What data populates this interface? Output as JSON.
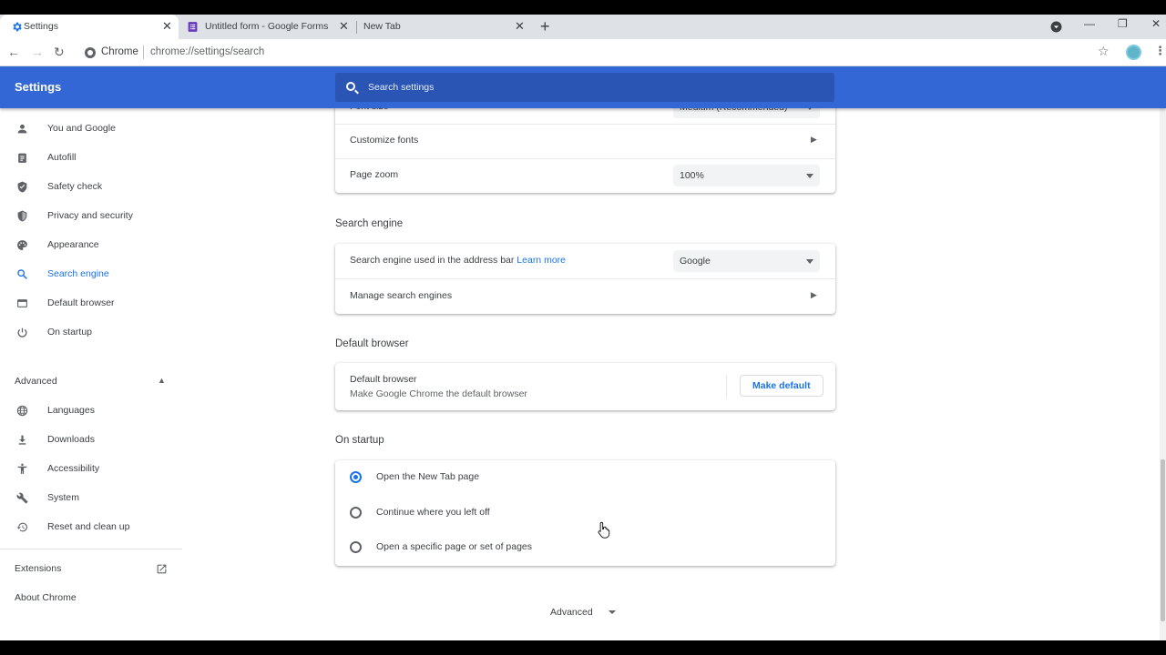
{
  "tabs": [
    {
      "title": "Settings",
      "icon": "gear-icon",
      "active": true
    },
    {
      "title": "Untitled form - Google Forms",
      "icon": "forms-icon",
      "active": false
    },
    {
      "title": "New Tab",
      "icon": "",
      "active": false
    }
  ],
  "toolbar": {
    "site_label": "Chrome",
    "url": "chrome://settings/search"
  },
  "header": {
    "title": "Settings",
    "search_placeholder": "Search settings"
  },
  "sidebar": {
    "items": [
      {
        "label": "You and Google",
        "icon": "person-icon"
      },
      {
        "label": "Autofill",
        "icon": "clipboard-icon"
      },
      {
        "label": "Safety check",
        "icon": "shield-check-icon"
      },
      {
        "label": "Privacy and security",
        "icon": "shield-icon"
      },
      {
        "label": "Appearance",
        "icon": "palette-icon"
      },
      {
        "label": "Search engine",
        "icon": "search-icon",
        "active": true
      },
      {
        "label": "Default browser",
        "icon": "browser-icon"
      },
      {
        "label": "On startup",
        "icon": "power-icon"
      }
    ],
    "advanced_label": "Advanced",
    "advanced_items": [
      {
        "label": "Languages",
        "icon": "globe-icon"
      },
      {
        "label": "Downloads",
        "icon": "download-icon"
      },
      {
        "label": "Accessibility",
        "icon": "accessibility-icon"
      },
      {
        "label": "System",
        "icon": "wrench-icon"
      },
      {
        "label": "Reset and clean up",
        "icon": "history-icon"
      }
    ],
    "extensions_label": "Extensions",
    "about_label": "About Chrome"
  },
  "appearance": {
    "font_size_label": "Font size",
    "font_size_value": "Medium (Recommended)",
    "customize_fonts_label": "Customize fonts",
    "page_zoom_label": "Page zoom",
    "page_zoom_value": "100%"
  },
  "search_engine": {
    "title": "Search engine",
    "used_label": "Search engine used in the address bar",
    "learn_more": "Learn more",
    "value": "Google",
    "manage_label": "Manage search engines"
  },
  "default_browser": {
    "title": "Default browser",
    "label": "Default browser",
    "sub": "Make Google Chrome the default browser",
    "button": "Make default"
  },
  "on_startup": {
    "title": "On startup",
    "options": [
      {
        "label": "Open the New Tab page",
        "checked": true
      },
      {
        "label": "Continue where you left off",
        "checked": false
      },
      {
        "label": "Open a specific page or set of pages",
        "checked": false
      }
    ]
  },
  "advanced_footer": "Advanced",
  "colors": {
    "accent": "#1a73e8",
    "header": "#3367d6",
    "search_bg": "#2a55b4"
  }
}
